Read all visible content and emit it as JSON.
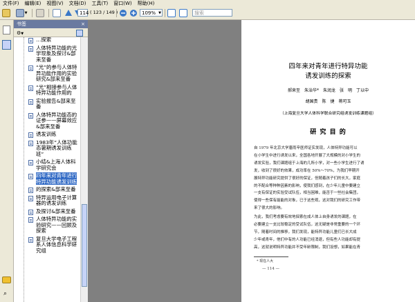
{
  "menu": [
    "文件(F)",
    "编辑(E)",
    "视图(V)",
    "文档(D)",
    "工具(T)",
    "窗口(W)",
    "帮助(H)"
  ],
  "toolbar": {
    "page_current": "114",
    "page_total": "( 123 / 149 )",
    "zoom": "109%",
    "search_placeholder": "搜索"
  },
  "panel": {
    "title": "书签",
    "close": "×"
  },
  "bookmarks": [
    {
      "text": "…探索",
      "selected": false
    },
    {
      "text": "人体特异功能的光学现象及探讨&部来至番",
      "selected": false
    },
    {
      "text": "“光”的参与人体特异功能作用的实验研究&部来至番",
      "selected": false
    },
    {
      "text": "“光”相接参与人体特异功能作用的",
      "selected": false
    },
    {
      "text": "实验报告&部来至番",
      "selected": false
    },
    {
      "text": "人体特异功能态的证参——屏幕效应&部来至番",
      "selected": false
    },
    {
      "text": "诱发训练",
      "selected": false
    },
    {
      "text": "1983年“人体功能态暑期诱发训练班”",
      "selected": false
    },
    {
      "text": "小结&上海人体科学研究会",
      "selected": false
    },
    {
      "text": "四年来对青年进行特异功能诱发训练",
      "selected": true
    },
    {
      "text": "的探索&部来至番",
      "selected": false
    },
    {
      "text": "特异运用电子计算器的诱发训练",
      "selected": false
    },
    {
      "text": "及探讨&部来至番",
      "selected": false
    },
    {
      "text": "人体特异功能的实验研究——回顾及探索",
      "selected": false
    },
    {
      "text": "复旦大学电子工程系人体信息科学研究组",
      "selected": false
    }
  ],
  "document": {
    "title_line1": "四年来对青年进行特异功能",
    "title_line2": "诱发训练的探索",
    "authors1": "郝来至　朱治华*　朱润龙　张　明　丁以中",
    "authors2": "胡国贵　陈　捷　蒋可玉",
    "affiliation": "（上海复旦大学人体科学联合研究组诱发训练课题组）",
    "section": "研 究 目 的",
    "para1_lines": [
      "自 1979 年北京大学唐雨辛医师证实发现，人体特异功能可以",
      "在小学生中进行诱发以来，全国各地开展了大规模的对小学生的",
      "诱发实验，我们课题组于上海的几所小学，对一些小学生进行了诱",
      "发，收到了很好的效果，成功率在 50%～70%，为我们早期开",
      "展特异功能研究提供了很好的保证，但随着孩子们的长大，家庭",
      "的不配合等种种因素的影响，使我们感到，在少年儿童中要建立",
      "一支有保证的实验受试队伍，相当困难，能否于一些社会集团，",
      "使得一些保有能能的对象，已于这些观，这对我们的研究工作带",
      "来了很大的影响。"
    ],
    "para2_lines": [
      "为此，我们考虑要有效地探索在成人体上自身诱发的课题，在",
      "必要建立一支比较稳定的受试队伍，这无疑是非常重要的一个环",
      "节，随着时间的推移，我们发现，能特异功能儿童们已长大成",
      "少年或青年，他们中有的人功能已经消退，但有些人功能却有提",
      "高，这就说明特异功能并不受年龄限制，我们设想，如果能在青"
    ],
    "footnote": "* 现在人大",
    "page_number": "— 114 —"
  }
}
